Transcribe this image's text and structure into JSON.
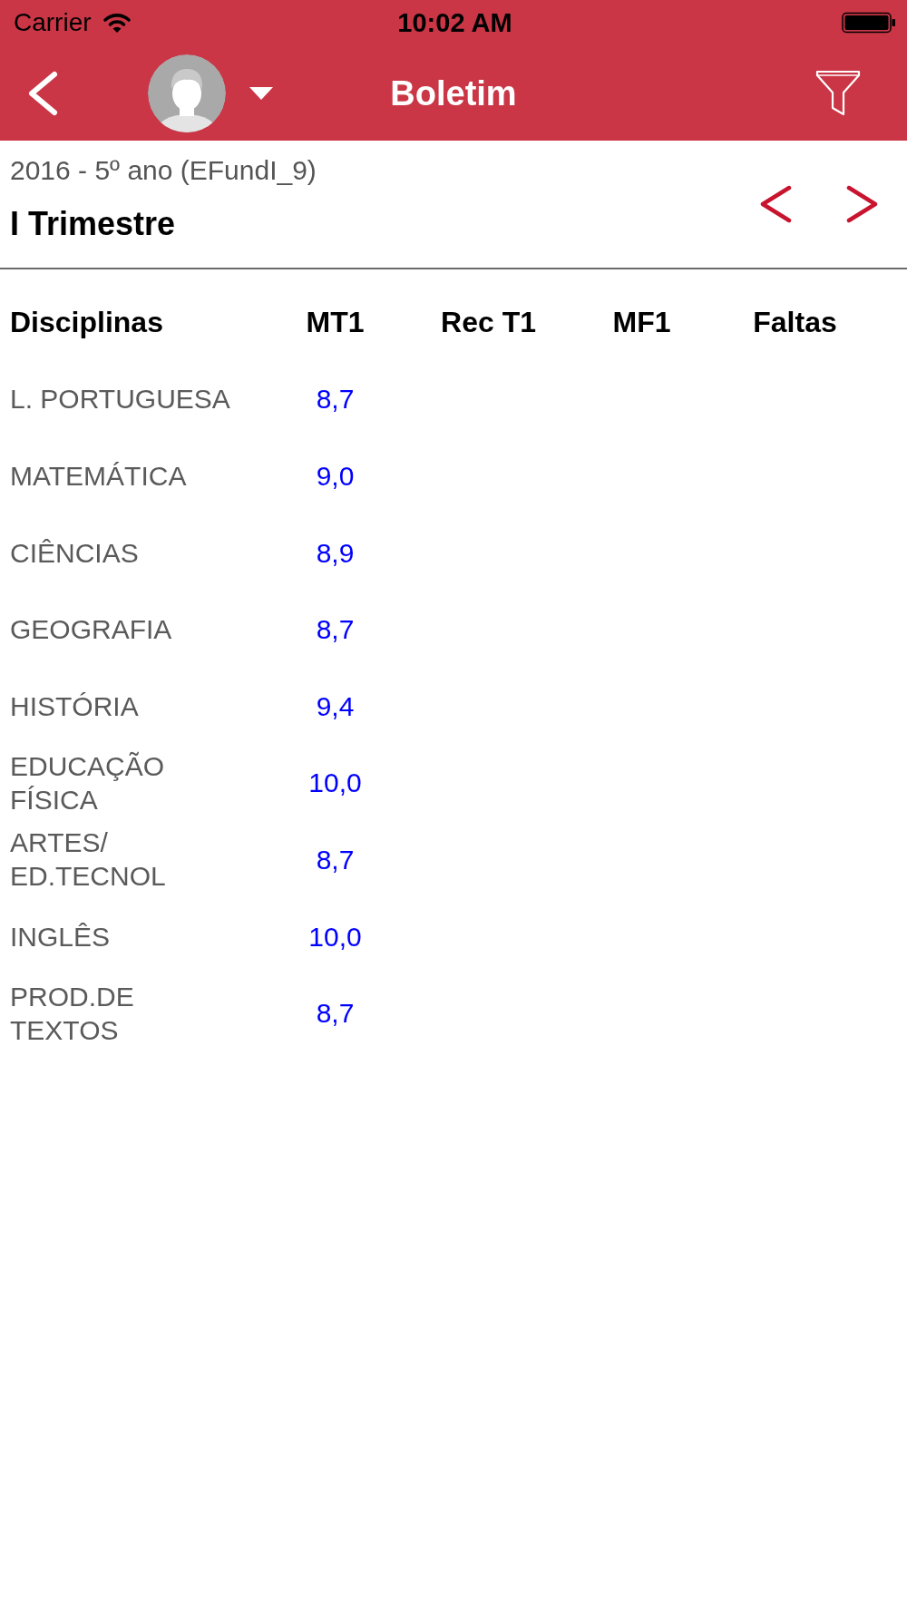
{
  "status_bar": {
    "carrier": "Carrier",
    "time": "10:02 AM"
  },
  "nav_bar": {
    "title": "Boletim"
  },
  "header": {
    "subtitle": "2016 - 5º ano (EFundI_9)",
    "period": "I Trimestre"
  },
  "table": {
    "columns": [
      "Disciplinas",
      "MT1",
      "Rec T1",
      "MF1",
      "Faltas"
    ],
    "rows": [
      {
        "cells": [
          "L. PORTUGUESA",
          "8,7"
        ]
      },
      {
        "cells": [
          "MATEMÁTICA",
          "9,0"
        ]
      },
      {
        "cells": [
          "CIÊNCIAS",
          "8,9"
        ]
      },
      {
        "cells": [
          "GEOGRAFIA",
          "8,7"
        ]
      },
      {
        "cells": [
          "HISTÓRIA",
          "9,4"
        ]
      },
      {
        "cells": [
          "EDUCAÇÃO FÍSICA",
          "10,0"
        ]
      },
      {
        "cells": [
          "ARTES/ED.TECNOL",
          "8,7"
        ]
      },
      {
        "cells": [
          "INGLÊS",
          "10,0"
        ]
      },
      {
        "cells": [
          "PROD.DE TEXTOS",
          "8,7"
        ]
      }
    ]
  }
}
